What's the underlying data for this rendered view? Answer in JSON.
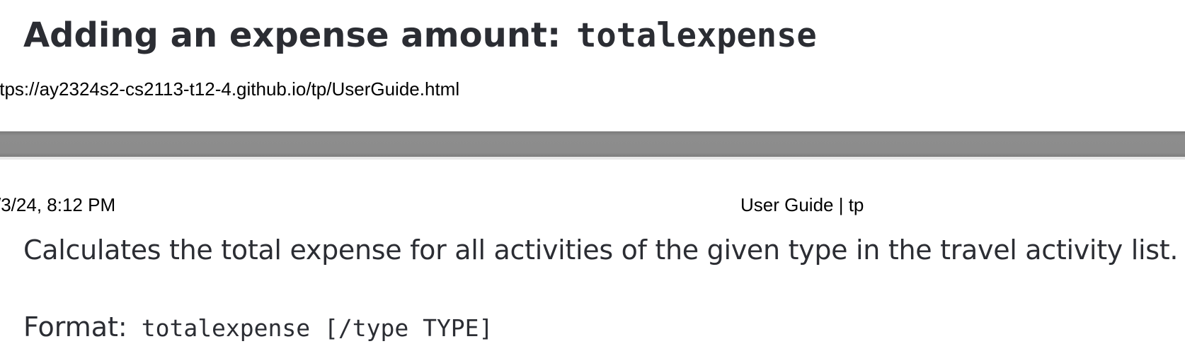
{
  "section": {
    "heading_text": "Adding an expense amount:",
    "heading_code": "totalexpense",
    "description": "Calculates the total expense for all activities of the given type in the travel activity list.",
    "format_label": "Format:",
    "format_code": "totalexpense [/type TYPE]"
  },
  "print_footer": {
    "url": "ttps://ay2324s2-cs2113-t12-4.github.io/tp/UserGuide.html"
  },
  "print_header": {
    "datetime": "/3/24, 8:12 PM",
    "title": "User Guide | tp"
  }
}
